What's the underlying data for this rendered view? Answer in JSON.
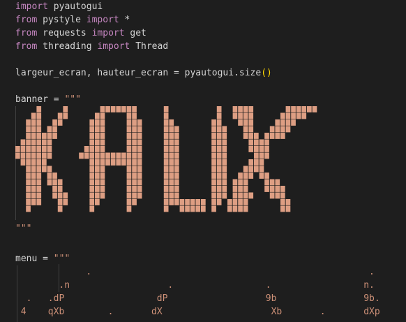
{
  "code": {
    "l1": {
      "kw": "import",
      "rest": " pyautogui"
    },
    "l2": {
      "kw1": "from",
      "mid": " pystyle ",
      "kw2": "import",
      "rest": " *"
    },
    "l3": {
      "kw1": "from",
      "mid": " requests ",
      "kw2": "import",
      "rest": " get"
    },
    "l4": {
      "kw1": "from",
      "mid": " threading ",
      "kw2": "import",
      "rest": " Thread"
    },
    "l6": {
      "text": "largeur_ecran, hauteur_ecran = pyautogui.size",
      "open": "(",
      "close": ")"
    },
    "l8": {
      "text": "banner = ",
      "str": "\"\"\""
    },
    "l17": {
      "str": "\"\"\""
    },
    "l20": {
      "text": "menu = ",
      "str": "\"\"\""
    }
  },
  "banner_art": {
    "word": "KAUX",
    "color": "#dd9e83"
  },
  "menu_art": {
    "color": "#ce9178",
    "rows": [
      [
        {
          "t": ".",
          "c": 13
        },
        {
          "t": ".",
          "c": 65
        }
      ],
      [
        {
          "t": ".n",
          "c": 8
        },
        {
          "t": ".",
          "c": 28
        },
        {
          "t": ".",
          "c": 46
        },
        {
          "t": "n.",
          "c": 64
        }
      ],
      [
        {
          "t": ".",
          "c": 2
        },
        {
          "t": ".dP",
          "c": 6
        },
        {
          "t": "dP",
          "c": 26
        },
        {
          "t": "9b",
          "c": 46
        },
        {
          "t": "9b.",
          "c": 64
        }
      ],
      [
        {
          "t": "4",
          "c": 1
        },
        {
          "t": "qXb",
          "c": 6
        },
        {
          "t": ".",
          "c": 17
        },
        {
          "t": "dX",
          "c": 25
        },
        {
          "t": "Xb",
          "c": 47
        },
        {
          "t": ".",
          "c": 56
        },
        {
          "t": "dXp",
          "c": 64
        }
      ]
    ]
  }
}
